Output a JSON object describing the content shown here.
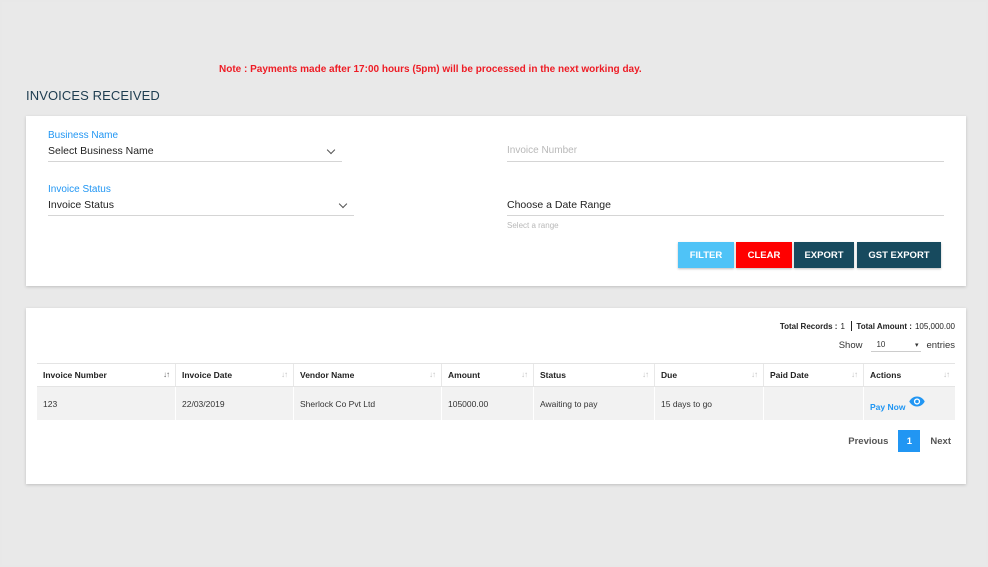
{
  "note": "Note : Payments made after 17:00 hours (5pm) will be processed in the next working day.",
  "page_title": "INVOICES RECEIVED",
  "filters": {
    "business_name_label": "Business Name",
    "business_name_value": "Select Business Name",
    "invoice_number_placeholder": "Invoice Number",
    "invoice_status_label": "Invoice Status",
    "invoice_status_value": "Invoice Status",
    "date_range_label": "Choose a Date Range",
    "date_range_hint": "Select a range"
  },
  "buttons": {
    "filter": "FILTER",
    "clear": "CLEAR",
    "export": "EXPORT",
    "gst_export": "GST EXPORT"
  },
  "summary": {
    "total_records_label": "Total Records :",
    "total_records_value": "1",
    "total_amount_label": "Total Amount :",
    "total_amount_value": "105,000.00"
  },
  "entries": {
    "show_label": "Show",
    "page_size": "10",
    "entries_label": "entries"
  },
  "table": {
    "columns": [
      "Invoice Number",
      "Invoice Date",
      "Vendor Name",
      "Amount",
      "Status",
      "Due",
      "Paid Date",
      "Actions"
    ],
    "rows": [
      {
        "invoice_number": "123",
        "invoice_date": "22/03/2019",
        "vendor_name": "Sherlock Co Pvt Ltd",
        "amount": "105000.00",
        "status": "Awaiting to pay",
        "due": "15 days to go",
        "paid_date": "",
        "action_label": "Pay Now"
      }
    ]
  },
  "pagination": {
    "previous": "Previous",
    "current": "1",
    "next": "Next"
  },
  "colors": {
    "note_red": "#ee1c25",
    "accent_blue": "#2196f3",
    "filter_button": "#4fc3f7",
    "clear_button": "#ff0000",
    "export_button": "#174a5e"
  },
  "icons": {
    "dropdown": "chevron-down-icon",
    "sort": "sort-icon",
    "view": "eye-icon"
  }
}
